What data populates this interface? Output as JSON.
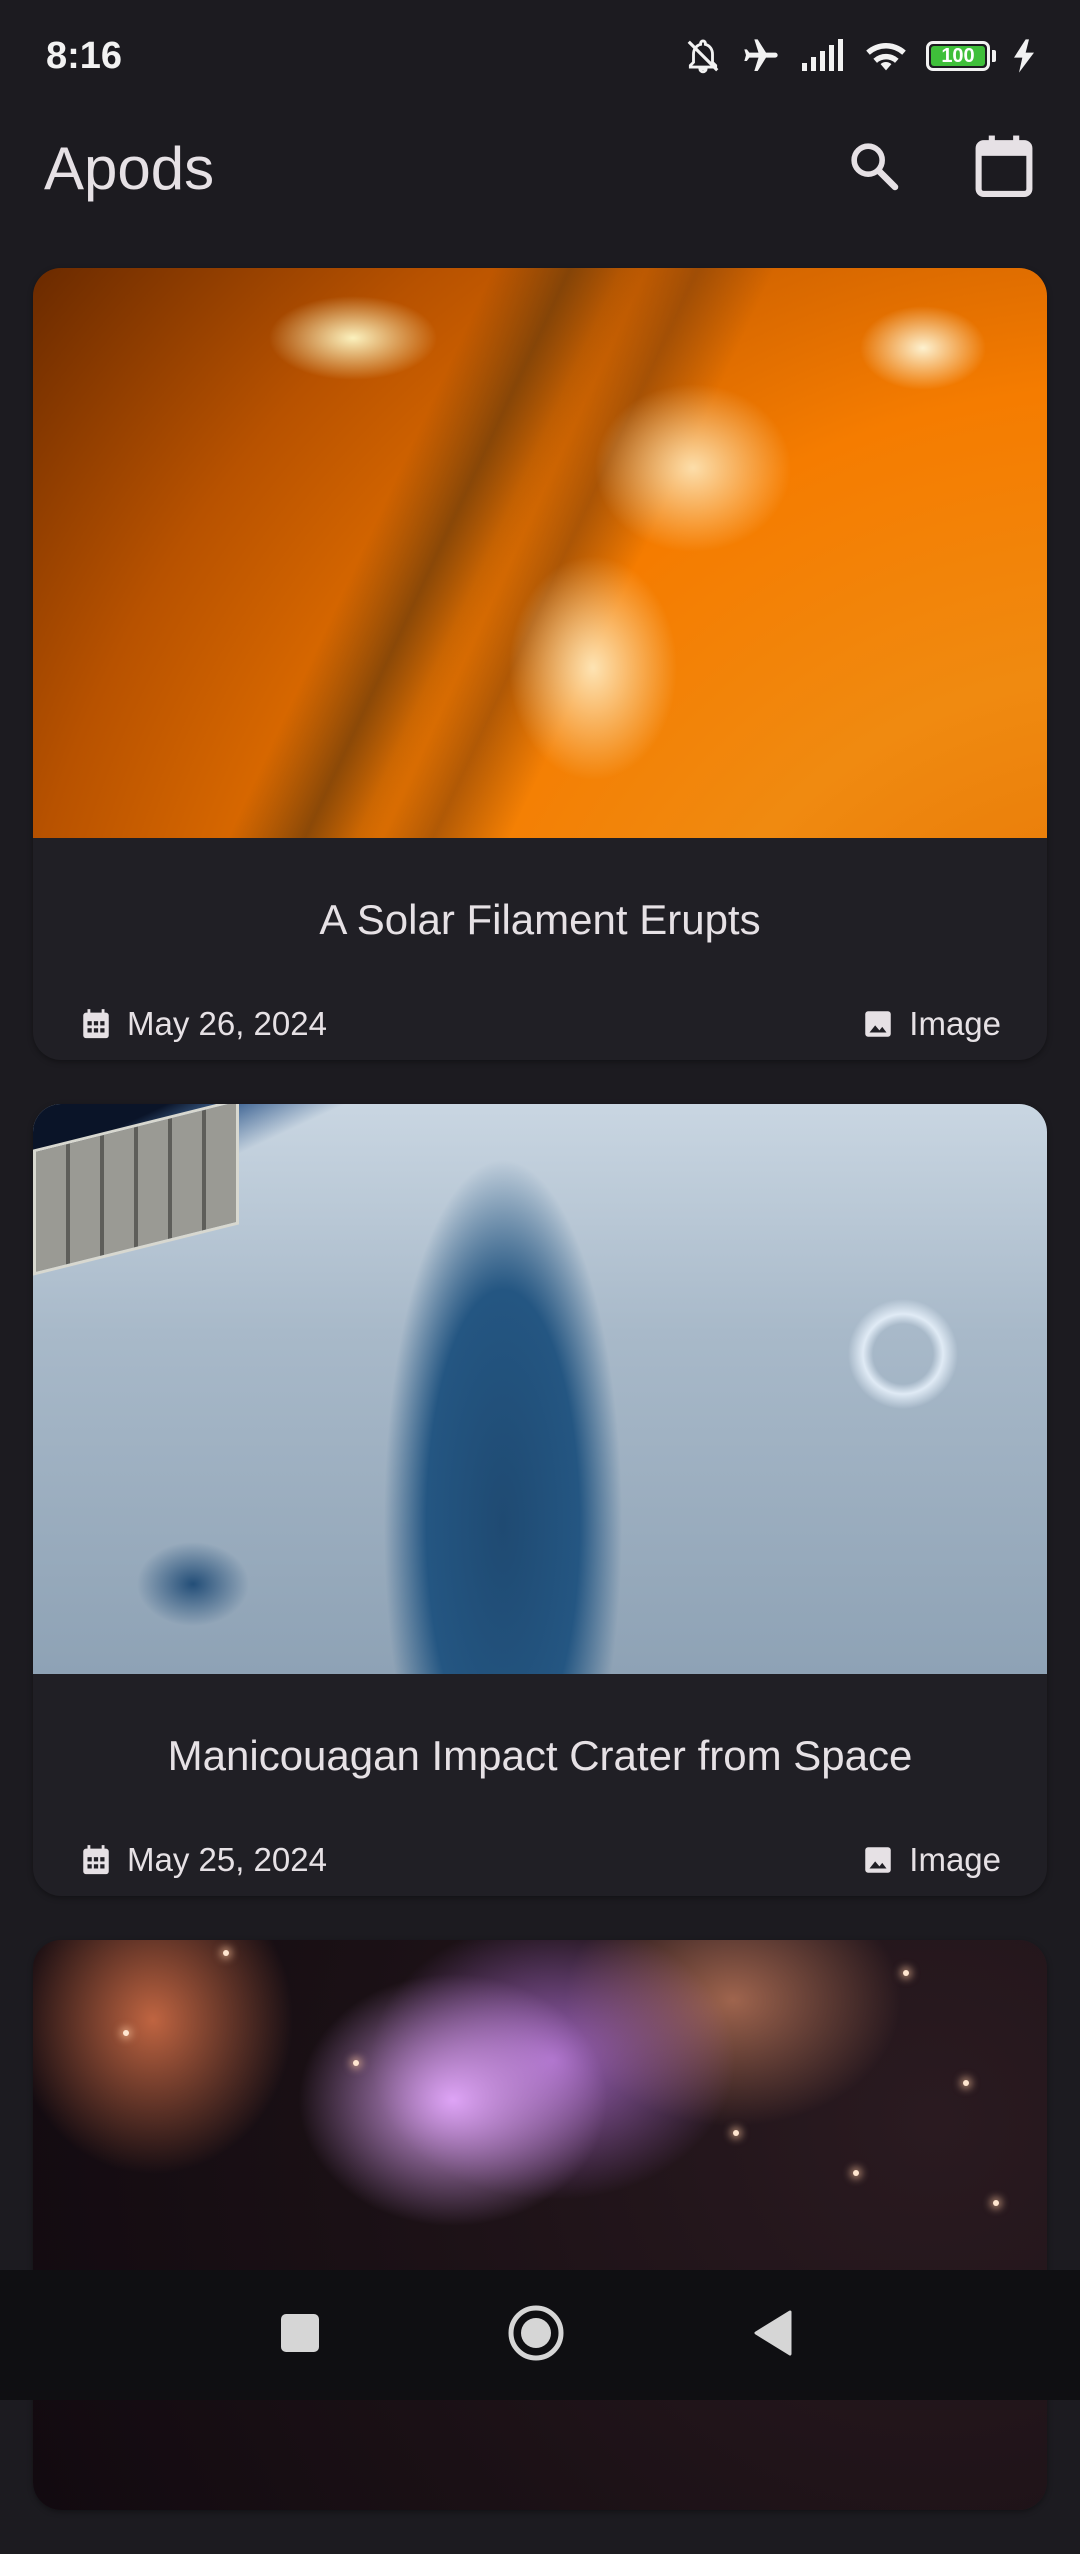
{
  "status_bar": {
    "time": "8:16",
    "battery_level": "100",
    "icons": [
      "bell-off-icon",
      "airplane-icon",
      "signal-icon",
      "wifi-icon",
      "battery-icon",
      "charging-icon"
    ]
  },
  "app_bar": {
    "title": "Apods",
    "actions": [
      "search-icon",
      "calendar-icon"
    ]
  },
  "apods": [
    {
      "title": "A Solar Filament Erupts",
      "date": "May 26, 2024",
      "media_type": "Image"
    },
    {
      "title": "Manicouagan Impact Crater from Space",
      "date": "May 25, 2024",
      "media_type": "Image"
    },
    {
      "title": "",
      "date": "",
      "media_type": ""
    }
  ],
  "nav_bar": {
    "buttons": [
      "recents-button",
      "home-button",
      "back-button"
    ]
  },
  "colors": {
    "background": "#1c1b20",
    "card": "#201f25",
    "text": "#e6e1e5",
    "battery_fill": "#3fbf3a"
  }
}
